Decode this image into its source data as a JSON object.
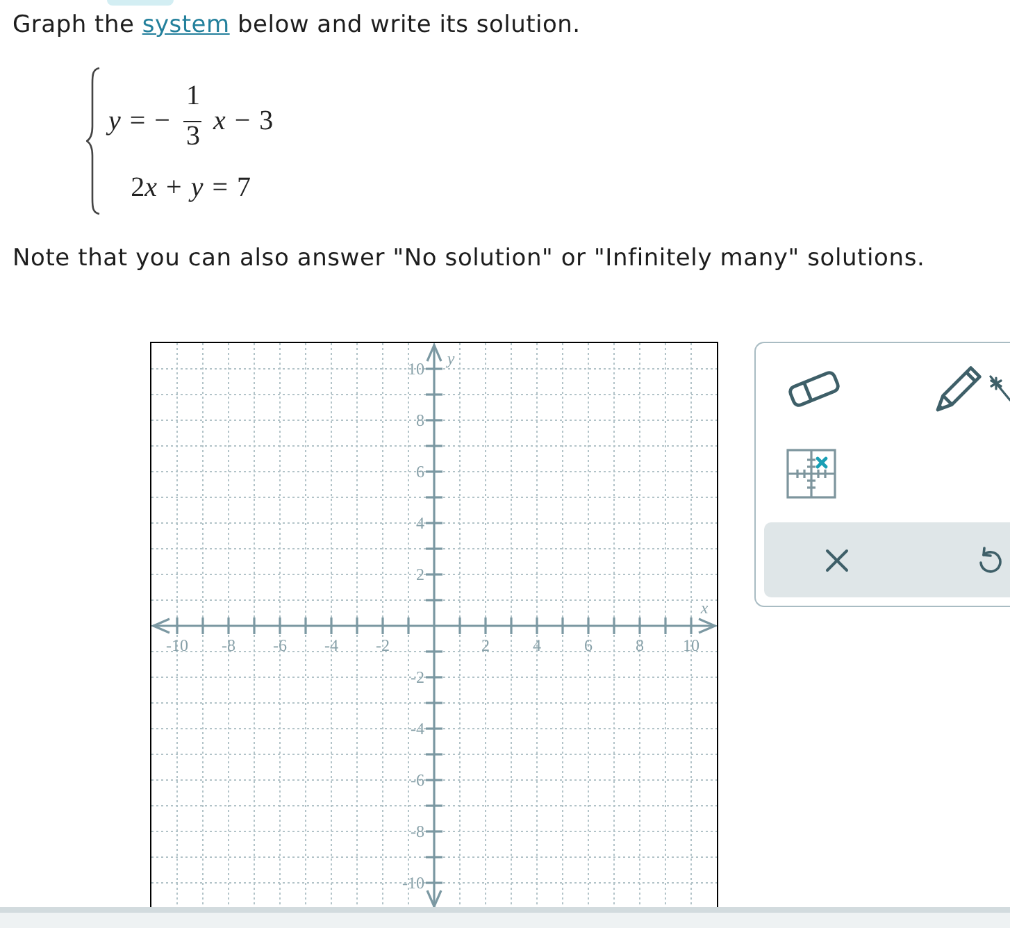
{
  "instruction": {
    "before": "Graph the ",
    "link": "system",
    "after": " below and write its solution."
  },
  "system": {
    "equations": [
      {
        "kind": "fraction",
        "before": "y = −",
        "numerator": "1",
        "denominator": "3",
        "after": "x − 3"
      },
      {
        "kind": "plain",
        "text": "2x + y = 7"
      }
    ]
  },
  "note": "Note that you can also answer \"No solution\" or \"Infinitely many\" solutions.",
  "graph": {
    "chart_data": {
      "type": "scatter",
      "xlabel": "x",
      "ylabel": "y",
      "xlim": [
        -11,
        11
      ],
      "ylim": [
        -11,
        11
      ],
      "xticks": [
        -10,
        -8,
        -6,
        -4,
        -2,
        2,
        4,
        6,
        8,
        10
      ],
      "yticks": [
        -10,
        -8,
        -6,
        -4,
        -2,
        2,
        4,
        6,
        8,
        10
      ],
      "grid": true
    }
  }
}
